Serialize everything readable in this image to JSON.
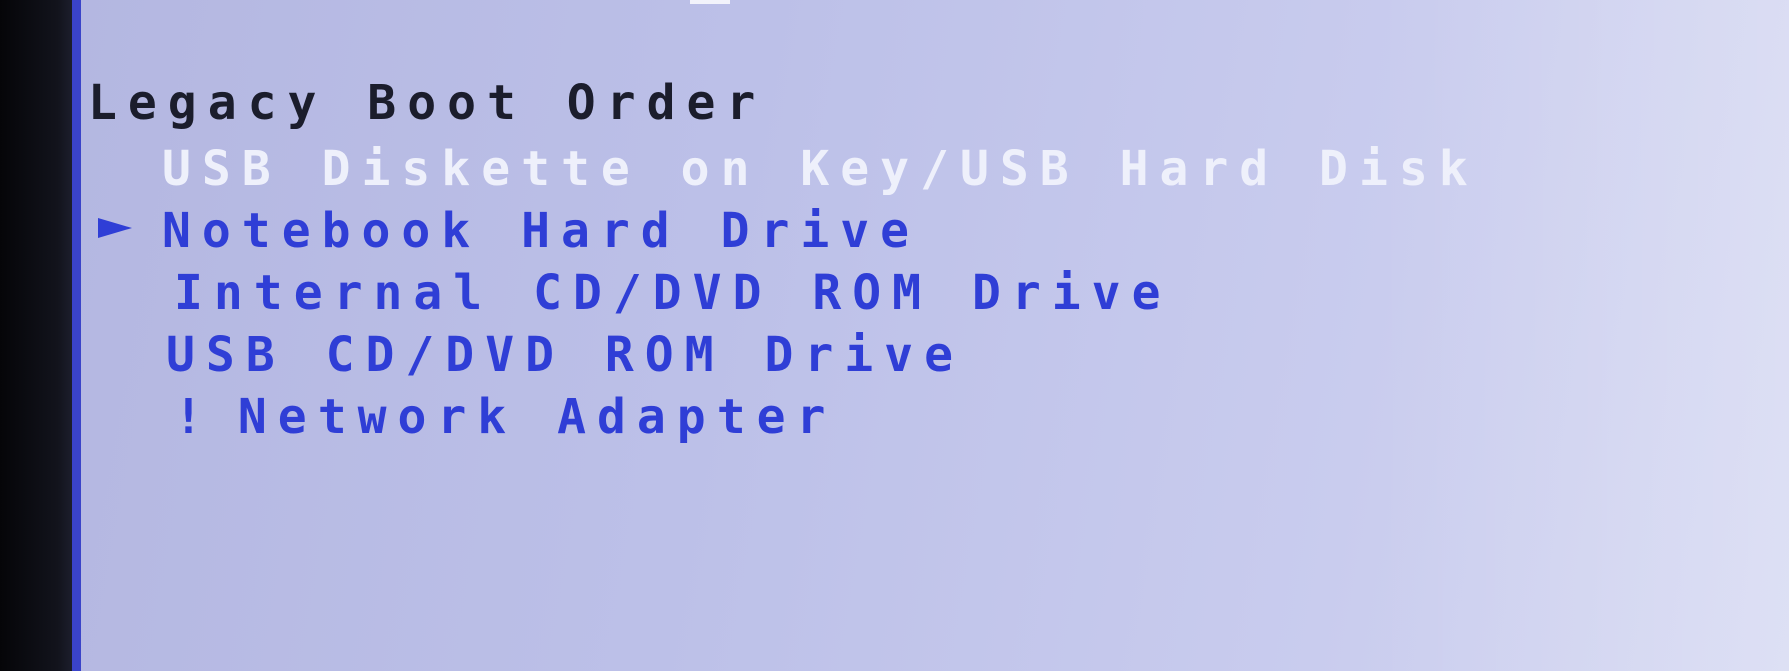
{
  "section": {
    "title": "Legacy Boot Order"
  },
  "boot_order": {
    "items": [
      {
        "label": "USB Diskette on Key/USB Hard Disk",
        "highlighted": true,
        "selected": false,
        "flag": ""
      },
      {
        "label": "Notebook Hard Drive",
        "highlighted": false,
        "selected": true,
        "flag": ""
      },
      {
        "label": "Internal CD/DVD ROM Drive",
        "highlighted": false,
        "selected": false,
        "flag": ""
      },
      {
        "label": "USB CD/DVD ROM Drive",
        "highlighted": false,
        "selected": false,
        "flag": ""
      },
      {
        "label": "Network Adapter",
        "highlighted": false,
        "selected": false,
        "flag": "!"
      }
    ]
  },
  "colors": {
    "background": "#bcc0e8",
    "item_text": "#2f3ed6",
    "highlight_text": "#eef0fb",
    "heading_text": "#1b1d2c",
    "frame_line": "#3a43c9"
  },
  "icons": {
    "selection_pointer": "triangle-right-icon"
  }
}
